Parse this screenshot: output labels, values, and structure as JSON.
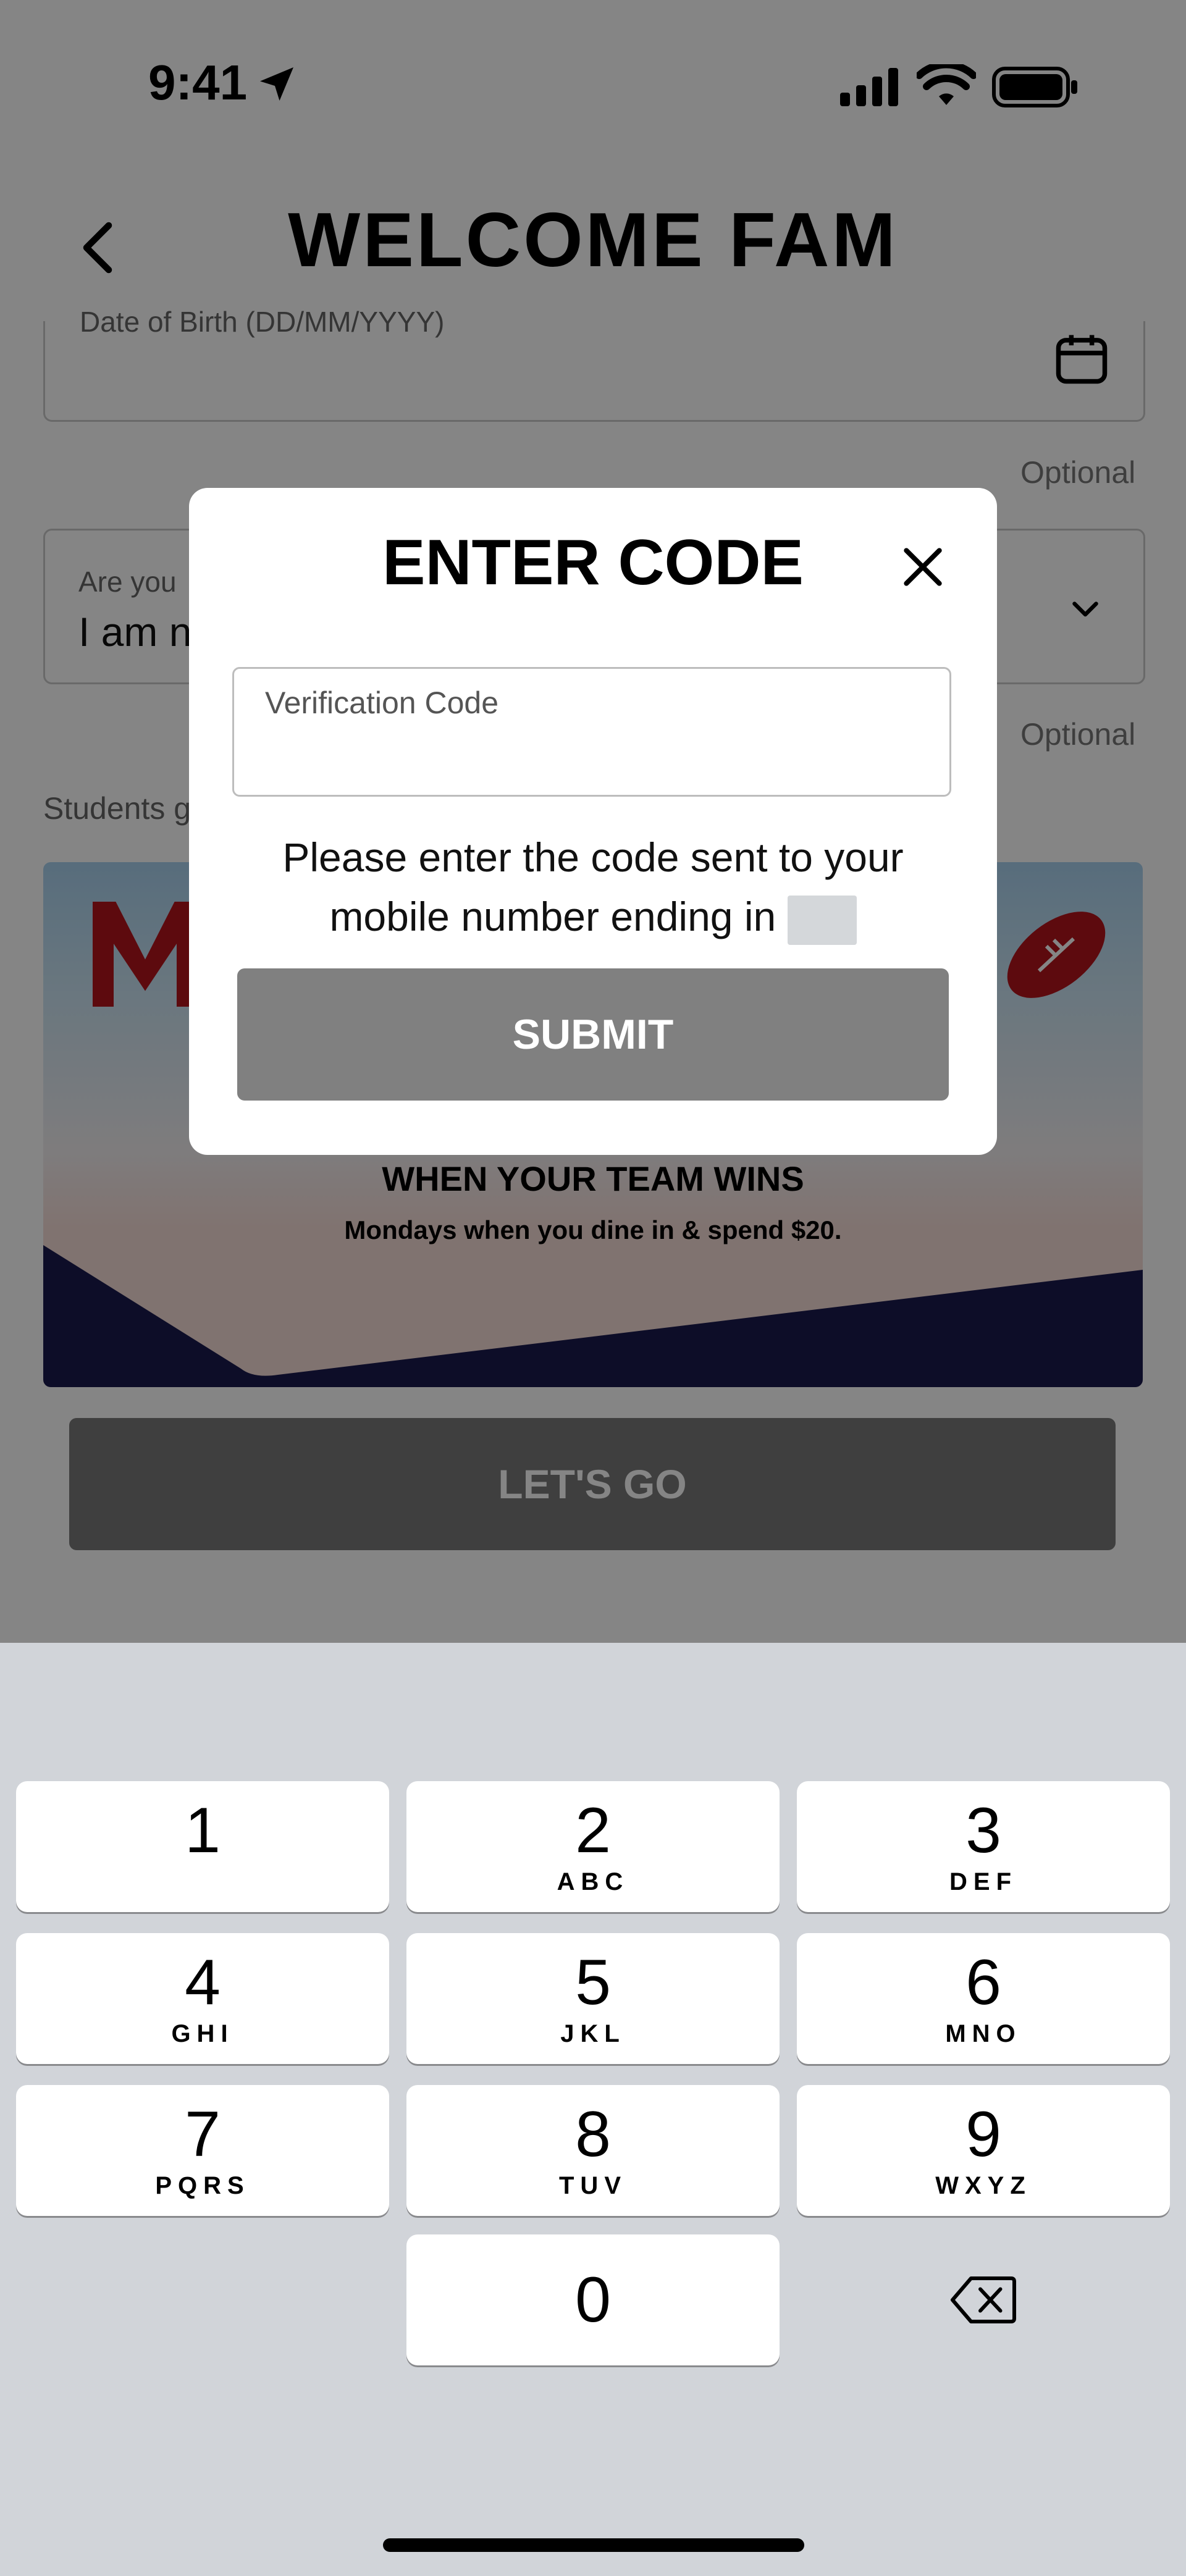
{
  "status_bar": {
    "time": "9:41"
  },
  "header": {
    "title": "WELCOME FAM"
  },
  "form": {
    "dob_label": "Date of Birth (DD/MM/YYYY)",
    "optional_1": "Optional",
    "are_you_label": "Are you",
    "are_you_value": "I am n",
    "optional_2": "Optional",
    "students_text": "Students g"
  },
  "banner": {
    "headline": "WHEN YOUR TEAM WINS",
    "subline": "Mondays when you dine in & spend $20.",
    "accent_color": "#b3151c",
    "navy_color": "#1a1a4e"
  },
  "lets_go_label": "LET'S GO",
  "modal": {
    "title": "ENTER CODE",
    "input_label": "Verification Code",
    "message_line1": "Please enter the code sent to your",
    "message_line2": "mobile number ending in",
    "submit_label": "SUBMIT"
  },
  "keyboard": {
    "keys": [
      {
        "num": "1",
        "letters": ""
      },
      {
        "num": "2",
        "letters": "ABC"
      },
      {
        "num": "3",
        "letters": "DEF"
      },
      {
        "num": "4",
        "letters": "GHI"
      },
      {
        "num": "5",
        "letters": "JKL"
      },
      {
        "num": "6",
        "letters": "MNO"
      },
      {
        "num": "7",
        "letters": "PQRS"
      },
      {
        "num": "8",
        "letters": "TUV"
      },
      {
        "num": "9",
        "letters": "WXYZ"
      },
      {
        "num": "0",
        "letters": ""
      }
    ],
    "delete_icon": "delete-backspace-icon"
  }
}
